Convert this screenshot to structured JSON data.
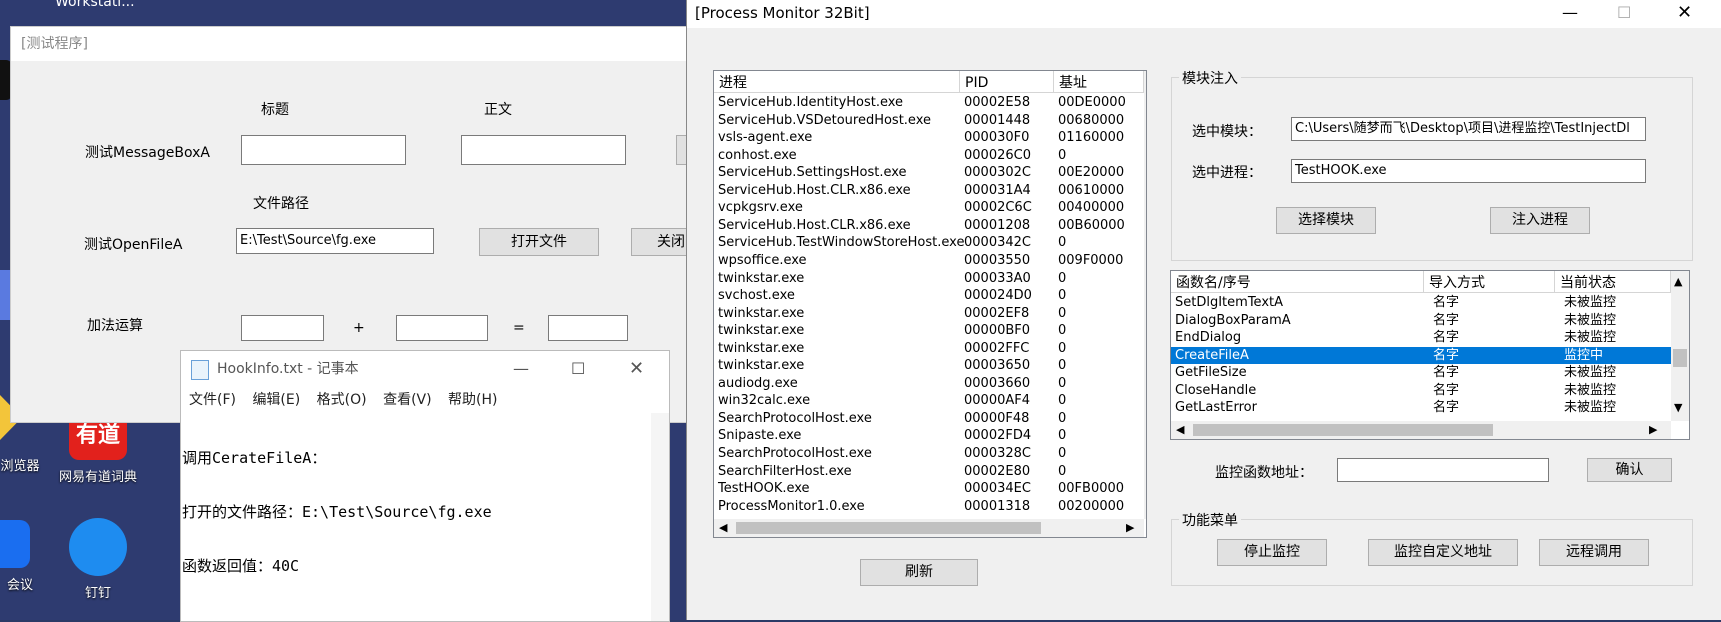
{
  "desktop": {
    "top_left_text": "Workstati...",
    "icons": [
      {
        "label": "浏览器"
      },
      {
        "label": "网易有道词典"
      },
      {
        "label": "会议"
      },
      {
        "label": "钉钉"
      }
    ]
  },
  "test_window": {
    "title": "[测试程序]",
    "header_title": "标题",
    "header_body": "正文",
    "label_msgbox": "测试MessageBoxA",
    "label_filepath": "文件路径",
    "label_openfile": "测试OpenFileA",
    "file_path_value": "E:\\Test\\Source\\fg.exe",
    "open_file_button": "打开文件",
    "close_button_partial": "关闭",
    "label_add": "加法运算",
    "plus": "+",
    "equals": "="
  },
  "notepad": {
    "title": "HookInfo.txt - 记事本",
    "menu": [
      "文件(F)",
      "编辑(E)",
      "格式(O)",
      "查看(V)",
      "帮助(H)"
    ],
    "lines": [
      "调用CerateFileA：",
      "打开的文件路径：E:\\Test\\Source\\fg.exe",
      "函数返回值：40C"
    ]
  },
  "pm": {
    "title": "[Process Monitor 32Bit]",
    "proc_headers": [
      "进程",
      "PID",
      "基址"
    ],
    "processes": [
      [
        "ServiceHub.IdentityHost.exe",
        "00002E58",
        "00DE0000"
      ],
      [
        "ServiceHub.VSDetouredHost.exe",
        "00001448",
        "00680000"
      ],
      [
        "vsls-agent.exe",
        "000030F0",
        "01160000"
      ],
      [
        "conhost.exe",
        "000026C0",
        "0"
      ],
      [
        "ServiceHub.SettingsHost.exe",
        "0000302C",
        "00E20000"
      ],
      [
        "ServiceHub.Host.CLR.x86.exe",
        "000031A4",
        "00610000"
      ],
      [
        "vcpkgsrv.exe",
        "00002C6C",
        "00400000"
      ],
      [
        "ServiceHub.Host.CLR.x86.exe",
        "00001208",
        "00B60000"
      ],
      [
        "ServiceHub.TestWindowStoreHost.exe",
        "0000342C",
        "0"
      ],
      [
        "wpsoffice.exe",
        "00003550",
        "009F0000"
      ],
      [
        "twinkstar.exe",
        "000033A0",
        "0"
      ],
      [
        "svchost.exe",
        "000024D0",
        "0"
      ],
      [
        "twinkstar.exe",
        "00002EF8",
        "0"
      ],
      [
        "twinkstar.exe",
        "00000BF0",
        "0"
      ],
      [
        "twinkstar.exe",
        "00002FFC",
        "0"
      ],
      [
        "twinkstar.exe",
        "00003650",
        "0"
      ],
      [
        "audiodg.exe",
        "00003660",
        "0"
      ],
      [
        "win32calc.exe",
        "00000AF4",
        "0"
      ],
      [
        "SearchProtocolHost.exe",
        "00000F48",
        "0"
      ],
      [
        "Snipaste.exe",
        "00002FD4",
        "0"
      ],
      [
        "SearchProtocolHost.exe",
        "0000328C",
        "0"
      ],
      [
        "SearchFilterHost.exe",
        "00002E80",
        "0"
      ],
      [
        "TestHOOK.exe",
        "000034EC",
        "00FB0000"
      ],
      [
        "ProcessMonitor1.0.exe",
        "00001318",
        "00200000"
      ]
    ],
    "refresh_button": "刷新",
    "inject_group": "模块注入",
    "selected_module_label": "选中模块：",
    "selected_module_value": "C:\\Users\\随梦而飞\\Desktop\\项目\\进程监控\\TestInjectDl",
    "selected_process_label": "选中进程：",
    "selected_process_value": "TestHOOK.exe",
    "select_module_button": "选择模块",
    "inject_process_button": "注入进程",
    "func_headers": [
      "函数名/序号",
      "导入方式",
      "当前状态"
    ],
    "functions": [
      [
        "SetDlgItemTextA",
        "名字",
        "未被监控"
      ],
      [
        "DialogBoxParamA",
        "名字",
        "未被监控"
      ],
      [
        "EndDialog",
        "名字",
        "未被监控"
      ],
      [
        "CreateFileA",
        "名字",
        "监控中"
      ],
      [
        "GetFileSize",
        "名字",
        "未被监控"
      ],
      [
        "CloseHandle",
        "名字",
        "未被监控"
      ],
      [
        "GetLastError",
        "名字",
        "未被监控"
      ]
    ],
    "monitor_addr_label": "监控函数地址：",
    "confirm_button": "确认",
    "func_menu_group": "功能菜单",
    "stop_monitor_button": "停止监控",
    "custom_addr_button": "监控自定义地址",
    "remote_call_button": "远程调用",
    "selection_color": "#0078d7"
  }
}
